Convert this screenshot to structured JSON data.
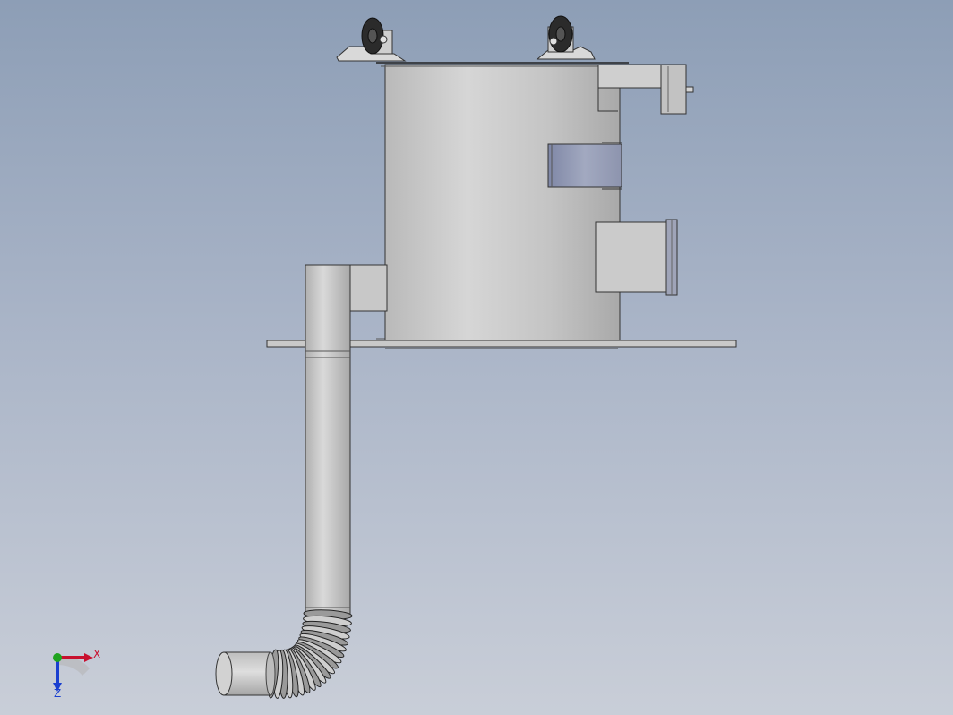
{
  "viewport": {
    "background_top": "#8d9eb6",
    "background_bottom": "#c9ced8"
  },
  "triad": {
    "x_label": "X",
    "z_label": "Z",
    "x_color": "#c8102e",
    "y_color": "#1fa31f",
    "z_color": "#1a3fd0"
  },
  "model": {
    "body_color": "#c6c6c6",
    "window_color": "#8e96b0",
    "wheel_color": "#2b2b2b",
    "parts": [
      "top-casters",
      "main-cylinder",
      "top-right-outlet",
      "side-window",
      "right-inlet-box",
      "base-plate",
      "left-elbow-box",
      "vertical-pipe",
      "flex-bellows",
      "end-nozzle"
    ]
  }
}
